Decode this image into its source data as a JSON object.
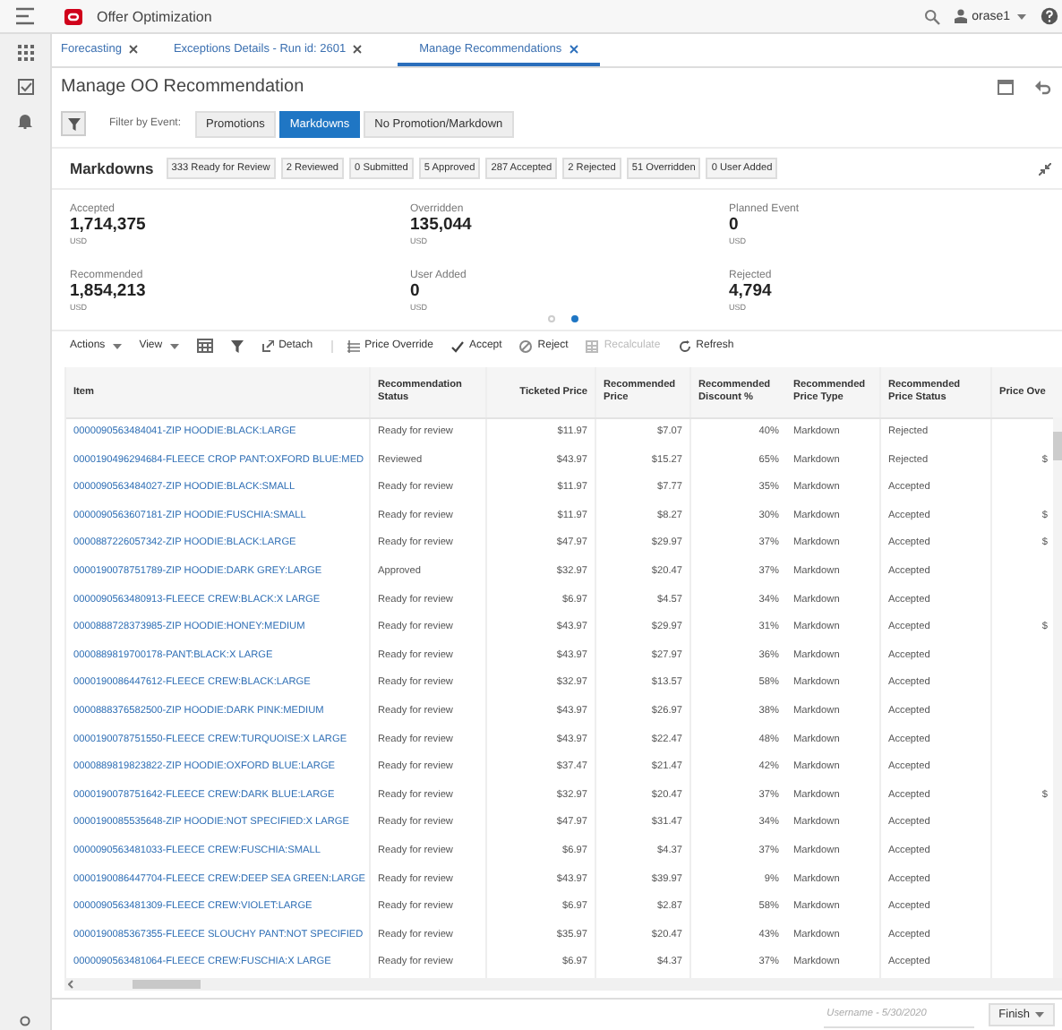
{
  "app": {
    "title": "Offer Optimization",
    "user": "orase1"
  },
  "tabs": [
    {
      "label": "Forecasting",
      "selected": false
    },
    {
      "label": "Exceptions Details - Run id: 2601",
      "selected": false
    },
    {
      "label": "Manage Recommendations",
      "selected": true
    }
  ],
  "page_title": "Manage OO Recommendation",
  "filter": {
    "label": "Filter by Event:",
    "options": [
      {
        "label": "Promotions",
        "selected": false
      },
      {
        "label": "Markdowns",
        "selected": true
      },
      {
        "label": "No Promotion/Markdown",
        "selected": false
      }
    ]
  },
  "markdowns": {
    "title": "Markdowns",
    "counts": [
      "333 Ready for Review",
      "2 Reviewed",
      "0 Submitted",
      "5 Approved",
      "287 Accepted",
      "2 Rejected",
      "51 Overridden",
      "0 User Added"
    ]
  },
  "summary": [
    {
      "label": "Accepted",
      "value": "1,714,375",
      "unit": "USD"
    },
    {
      "label": "Overridden",
      "value": "135,044",
      "unit": "USD"
    },
    {
      "label": "Planned Event",
      "value": "0",
      "unit": "USD"
    },
    {
      "label": "Recommended",
      "value": "1,854,213",
      "unit": "USD"
    },
    {
      "label": "User Added",
      "value": "0",
      "unit": "USD"
    },
    {
      "label": "Rejected",
      "value": "4,794",
      "unit": "USD"
    }
  ],
  "carousel": [
    {
      "selected": false
    },
    {
      "selected": true
    }
  ],
  "toolbar": [
    {
      "label": "Actions",
      "kind": "menu",
      "disabled": false
    },
    {
      "label": "View",
      "kind": "menu",
      "disabled": false
    },
    {
      "kind": "calendar",
      "disabled": false
    },
    {
      "kind": "filter",
      "disabled": false
    },
    {
      "label": "Detach",
      "kind": "detach",
      "disabled": false
    },
    {
      "label": "Price Override",
      "kind": "override",
      "disabled": false
    },
    {
      "label": "Accept",
      "kind": "accept",
      "disabled": false
    },
    {
      "label": "Reject",
      "kind": "reject",
      "disabled": false
    },
    {
      "label": "Recalculate",
      "kind": "recalc",
      "disabled": true
    },
    {
      "label": "Refresh",
      "kind": "refresh",
      "disabled": false
    }
  ],
  "table": {
    "columns": [
      "Item",
      "Recommendation Status",
      "Ticketed Price",
      "Recommended Price",
      "Recommended Discount %",
      "Recommended Price Type",
      "Recommended Price Status",
      "Price Ove"
    ],
    "rows": [
      {
        "item": "0000090563484041-ZIP HOODIE:BLACK:LARGE",
        "status": "Ready for review",
        "ticketed": "$11.97",
        "price": "$7.07",
        "discount": "40%",
        "type": "Markdown",
        "price_status": "Rejected"
      },
      {
        "item": "0000190496294684-FLEECE CROP PANT:OXFORD BLUE:MED",
        "status": "Reviewed",
        "ticketed": "$43.97",
        "price": "$15.27",
        "discount": "65%",
        "type": "Markdown",
        "price_status": "Rejected",
        "override": "$"
      },
      {
        "item": "0000090563484027-ZIP HOODIE:BLACK:SMALL",
        "status": "Ready for review",
        "ticketed": "$11.97",
        "price": "$7.77",
        "discount": "35%",
        "type": "Markdown",
        "price_status": "Accepted"
      },
      {
        "item": "0000090563607181-ZIP HOODIE:FUSCHIA:SMALL",
        "status": "Ready for review",
        "ticketed": "$11.97",
        "price": "$8.27",
        "discount": "30%",
        "type": "Markdown",
        "price_status": "Accepted",
        "override": "$"
      },
      {
        "item": "0000887226057342-ZIP HOODIE:BLACK:LARGE",
        "status": "Ready for review",
        "ticketed": "$47.97",
        "price": "$29.97",
        "discount": "37%",
        "type": "Markdown",
        "price_status": "Accepted",
        "override": "$"
      },
      {
        "item": "0000190078751789-ZIP HOODIE:DARK GREY:LARGE",
        "status": "Approved",
        "ticketed": "$32.97",
        "price": "$20.47",
        "discount": "37%",
        "type": "Markdown",
        "price_status": "Accepted"
      },
      {
        "item": "0000090563480913-FLEECE CREW:BLACK:X LARGE",
        "status": "Ready for review",
        "ticketed": "$6.97",
        "price": "$4.57",
        "discount": "34%",
        "type": "Markdown",
        "price_status": "Accepted"
      },
      {
        "item": "0000888728373985-ZIP HOODIE:HONEY:MEDIUM",
        "status": "Ready for review",
        "ticketed": "$43.97",
        "price": "$29.97",
        "discount": "31%",
        "type": "Markdown",
        "price_status": "Accepted",
        "override": "$"
      },
      {
        "item": "0000889819700178-PANT:BLACK:X LARGE",
        "status": "Ready for review",
        "ticketed": "$43.97",
        "price": "$27.97",
        "discount": "36%",
        "type": "Markdown",
        "price_status": "Accepted"
      },
      {
        "item": "0000190086447612-FLEECE CREW:BLACK:LARGE",
        "status": "Ready for review",
        "ticketed": "$32.97",
        "price": "$13.57",
        "discount": "58%",
        "type": "Markdown",
        "price_status": "Accepted"
      },
      {
        "item": "0000888376582500-ZIP HOODIE:DARK PINK:MEDIUM",
        "status": "Ready for review",
        "ticketed": "$43.97",
        "price": "$26.97",
        "discount": "38%",
        "type": "Markdown",
        "price_status": "Accepted"
      },
      {
        "item": "0000190078751550-FLEECE CREW:TURQUOISE:X LARGE",
        "status": "Ready for review",
        "ticketed": "$43.97",
        "price": "$22.47",
        "discount": "48%",
        "type": "Markdown",
        "price_status": "Accepted"
      },
      {
        "item": "0000889819823822-ZIP HOODIE:OXFORD BLUE:LARGE",
        "status": "Ready for review",
        "ticketed": "$37.47",
        "price": "$21.47",
        "discount": "42%",
        "type": "Markdown",
        "price_status": "Accepted"
      },
      {
        "item": "0000190078751642-FLEECE CREW:DARK BLUE:LARGE",
        "status": "Ready for review",
        "ticketed": "$32.97",
        "price": "$20.47",
        "discount": "37%",
        "type": "Markdown",
        "price_status": "Accepted",
        "override": "$"
      },
      {
        "item": "0000190085535648-ZIP HOODIE:NOT SPECIFIED:X LARGE",
        "status": "Ready for review",
        "ticketed": "$47.97",
        "price": "$31.47",
        "discount": "34%",
        "type": "Markdown",
        "price_status": "Accepted"
      },
      {
        "item": "0000090563481033-FLEECE CREW:FUSCHIA:SMALL",
        "status": "Ready for review",
        "ticketed": "$6.97",
        "price": "$4.37",
        "discount": "37%",
        "type": "Markdown",
        "price_status": "Accepted"
      },
      {
        "item": "0000190086447704-FLEECE CREW:DEEP SEA GREEN:LARGE",
        "status": "Ready for review",
        "ticketed": "$43.97",
        "price": "$39.97",
        "discount": "9%",
        "type": "Markdown",
        "price_status": "Accepted"
      },
      {
        "item": "0000090563481309-FLEECE CREW:VIOLET:LARGE",
        "status": "Ready for review",
        "ticketed": "$6.97",
        "price": "$2.87",
        "discount": "58%",
        "type": "Markdown",
        "price_status": "Accepted"
      },
      {
        "item": "0000190085367355-FLEECE SLOUCHY PANT:NOT SPECIFIED",
        "status": "Ready for review",
        "ticketed": "$35.97",
        "price": "$20.47",
        "discount": "43%",
        "type": "Markdown",
        "price_status": "Accepted"
      },
      {
        "item": "0000090563481064-FLEECE CREW:FUSCHIA:X LARGE",
        "status": "Ready for review",
        "ticketed": "$6.97",
        "price": "$4.37",
        "discount": "37%",
        "type": "Markdown",
        "price_status": "Accepted"
      }
    ]
  },
  "footer": {
    "placeholder": "Username - 5/30/2020",
    "button": "Finish"
  }
}
